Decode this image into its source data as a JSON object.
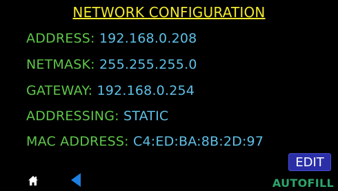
{
  "header": {
    "title": "NETWORK CONFIGURATION"
  },
  "fields": [
    {
      "label": "ADDRESS:",
      "value": "192.168.0.208"
    },
    {
      "label": "NETMASK:",
      "value": "255.255.255.0"
    },
    {
      "label": "GATEWAY:",
      "value": "192.168.0.254"
    },
    {
      "label": "ADDRESSING:",
      "value": "STATIC"
    },
    {
      "label": "MAC ADDRESS:",
      "value": "C4:ED:BA:8B:2D:97"
    }
  ],
  "actions": {
    "edit_label": "EDIT"
  },
  "footer": {
    "home_icon": "home-icon",
    "back_icon": "back-arrow-icon",
    "autofill_label": "AUTOFILL"
  },
  "colors": {
    "background": "#000000",
    "title": "#f2ea2f",
    "label": "#5fc64a",
    "value": "#5fc0e6",
    "button": "#2a2fa8",
    "back_arrow": "#1e7fe0",
    "autofill": "#2fa36a"
  }
}
